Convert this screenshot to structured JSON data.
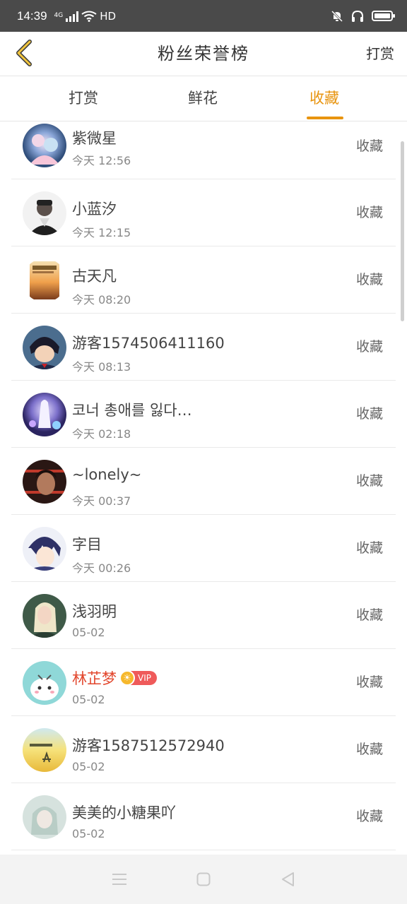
{
  "status_bar": {
    "time": "14:39",
    "network": "4G",
    "hd": "HD"
  },
  "header": {
    "title": "粉丝荣誉榜",
    "action": "打赏"
  },
  "tabs": [
    {
      "label": "打赏",
      "active": false
    },
    {
      "label": "鲜花",
      "active": false
    },
    {
      "label": "收藏",
      "active": true
    }
  ],
  "accent_color": "#e8940f",
  "vip_name_color": "#e2462c",
  "list": [
    {
      "name": "紫微星",
      "time": "今天 12:56",
      "tag": "收藏"
    },
    {
      "name": "小蓝汐",
      "time": "今天 12:15",
      "tag": "收藏"
    },
    {
      "name": "古天凡",
      "time": "今天 08:20",
      "tag": "收藏"
    },
    {
      "name": "游客1574506411160",
      "time": "今天 08:13",
      "tag": "收藏"
    },
    {
      "name": "코너 총애를 잃다…",
      "time": "今天 02:18",
      "tag": "收藏"
    },
    {
      "name": "~lonely~",
      "time": "今天 00:37",
      "tag": "收藏"
    },
    {
      "name": "字目",
      "time": "今天 00:26",
      "tag": "收藏"
    },
    {
      "name": "浅羽明",
      "time": "05-02",
      "tag": "收藏"
    },
    {
      "name": "林芷梦",
      "time": "05-02",
      "tag": "收藏",
      "vip": "VIP"
    },
    {
      "name": "游客1587512572940",
      "time": "05-02",
      "tag": "收藏"
    },
    {
      "name": "美美的小糖果吖",
      "time": "05-02",
      "tag": "收藏"
    }
  ]
}
